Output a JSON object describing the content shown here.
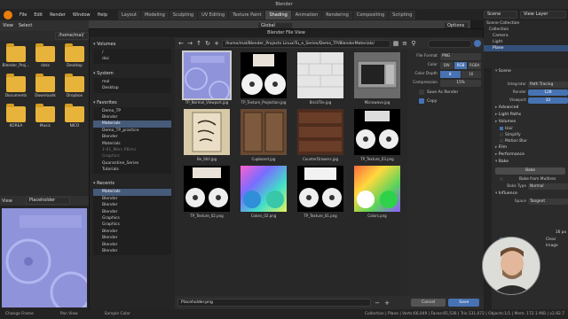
{
  "window": {
    "title": "Blender"
  },
  "menu": {
    "items": [
      "File",
      "Edit",
      "Render",
      "Window",
      "Help"
    ],
    "workspaces": [
      "Layout",
      "Modeling",
      "Sculpting",
      "UV Editing",
      "Texture Paint",
      "Shading",
      "Animation",
      "Rendering",
      "Compositing",
      "Scripting"
    ],
    "active_workspace": "Shading",
    "scene": "Scene",
    "view_layer": "View Layer"
  },
  "left_browser": {
    "header": [
      "View",
      "Select"
    ],
    "path": "/home/mal/",
    "folders": [
      "Blender_Proj...",
      "data",
      "Desktop",
      "Documents",
      "Downloads",
      "Dropbox",
      "KOREA",
      "Music",
      "NICO"
    ]
  },
  "image_editor": {
    "header": [
      "View",
      "Placeholder"
    ]
  },
  "viewport": {
    "orientation": "Global",
    "options": "Options"
  },
  "dialog": {
    "title": "Blender File View",
    "path": "/home/mal/Blender_Projects Linux/Tu_e_Series/Demo_TP/BlenderMaterials/",
    "sections": {
      "volumes": "Volumes",
      "system": "System",
      "favorites": "Favorites",
      "recents": "Recents"
    },
    "volumes": [
      "/",
      "doc"
    ],
    "system": [
      "mal",
      "Desktop"
    ],
    "favorites": [
      "Demo_TP",
      "Blender",
      "Materials",
      "Demo_TP_practice",
      "Blender",
      "Materials",
      "1-01_Merc.PBrmi",
      "Graphics",
      "Quarantine_Series",
      "Tutorials"
    ],
    "recents": [
      "Materials",
      "Blender",
      "Blender",
      "Blender",
      "Graphics",
      "Graphics",
      "Blender",
      "Blender",
      "Blender",
      "Blender"
    ],
    "files": [
      "TP_Normal_Viewport.jpg",
      "TP_Texture_Projection.jpg",
      "BrickTile.jpg",
      "Microwave.jpg",
      "Be_Still.jpg",
      "Cupboard.jpg",
      "CounterDrawers.jpg",
      "TP_Texture_03.png",
      "TP_Texture_02.png",
      "Colors_02.png",
      "TP_Texture_01.png",
      "Colors.png"
    ],
    "selected_file": "TP_Normal_Viewport.jpg",
    "options": {
      "file_format_label": "File Format",
      "file_format": "PNG",
      "color_label": "Color",
      "color_modes": [
        "BW",
        "RGB",
        "RGBA"
      ],
      "color_active": "RGB",
      "depth_label": "Color Depth",
      "depths": [
        "8",
        "16"
      ],
      "depth_active": "8",
      "compression_label": "Compression",
      "compression": "15%",
      "save_as_render": "Save As Render",
      "copy": "Copy"
    },
    "filename": "Placeholder.png",
    "cancel": "Cancel",
    "save": "Save"
  },
  "outliner": {
    "rows": [
      "Scene Collection",
      "Collection",
      "Camera",
      "Light",
      "Plane"
    ],
    "selected": "Plane"
  },
  "properties": {
    "scene_label": "Scene",
    "integrator_label": "Integrator",
    "integrator": "Path Tracing",
    "render_label": "Render",
    "render": "128",
    "viewport_label": "Viewport",
    "viewport": "32",
    "sections": [
      "Advanced",
      "Light Paths",
      "Volumes",
      "Hair",
      "Simplify",
      "Motion Blur",
      "Film",
      "Performance",
      "Bake"
    ],
    "bake_button": "Bake",
    "bake_from_multires": "Bake from Multires",
    "bake_type_label": "Bake Type",
    "bake_type": "Normal",
    "influence": "Influence",
    "space_label": "Space",
    "space": "Tangent",
    "px": "16 px",
    "clear_image": "Clear Image"
  },
  "status": {
    "left": "Change Frame",
    "middle": "Pan View",
    "right": "Sample Color",
    "stats": "Collection | Plane | Verts:66,049 | Faces:65,536 | Tris:131,072 | Objects:1/1 | Mem: 172.1 MiB | v2.82.7"
  },
  "colors": {
    "accent": "#4772b3",
    "folder": "#e8b33a",
    "normal_map": "#8f93d9"
  }
}
